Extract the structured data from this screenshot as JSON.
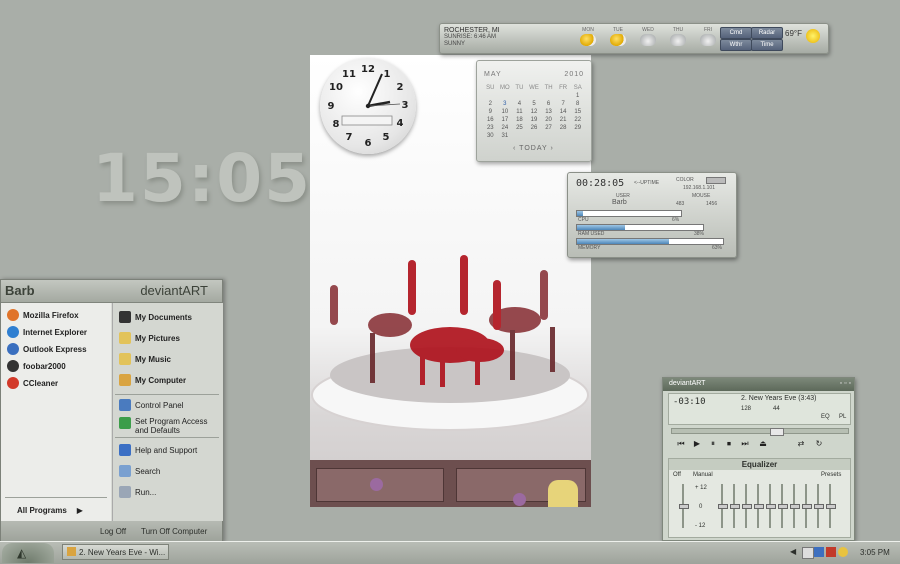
{
  "desktop": {
    "big_time": "15:05"
  },
  "clock_widget": {
    "numbers": [
      "12",
      "1",
      "2",
      "3",
      "4",
      "5",
      "6",
      "7",
      "8",
      "9",
      "10",
      "11"
    ],
    "time_shown": "2:11:15"
  },
  "calendar_widget": {
    "month": "MAY",
    "year": "2010",
    "weekdays": [
      "SU",
      "MO",
      "TU",
      "WE",
      "TH",
      "FR",
      "SA"
    ],
    "days": [
      "",
      "",
      "",
      "",
      "",
      "",
      "1",
      "2",
      "3",
      "4",
      "5",
      "6",
      "7",
      "8",
      "9",
      "10",
      "11",
      "12",
      "13",
      "14",
      "15",
      "16",
      "17",
      "18",
      "19",
      "20",
      "21",
      "22",
      "23",
      "24",
      "25",
      "26",
      "27",
      "28",
      "29",
      "30",
      "31"
    ],
    "today_label": "TODAY"
  },
  "weather_widget": {
    "location": "ROCHESTER, MI",
    "line2": "SUNRISE: 6:46 AM",
    "line3": "SUNNY",
    "days": [
      "MON",
      "TUE",
      "WED",
      "THU",
      "FRI"
    ],
    "buttons": [
      "Cmd",
      "Radar",
      "Wthr",
      "Time"
    ],
    "temperature": "69°F"
  },
  "system_monitor": {
    "uptime_value": "00:28:05",
    "uptime_label": "<--UPTIME",
    "color_label": "COLOR",
    "ip": "192.168.1.101",
    "mouse_label": "MOUSE",
    "user_label": "USER",
    "user_name": "Barb",
    "coords": "483",
    "coords2": "1456",
    "cpu_label": "CPU",
    "cpu_value": "6%",
    "cpu_pct": 6,
    "ram_label": "RAM USED",
    "ram_value": "38%",
    "ram_pct": 38,
    "mem_label": "MEMORY",
    "mem_value": "63%",
    "mem_pct": 63
  },
  "start_menu": {
    "user_name": "Barb",
    "brand": "deviantART",
    "pinned": [
      {
        "label": "Mozilla Firefox",
        "color": "#e0742a"
      },
      {
        "label": "Internet Explorer",
        "color": "#2f7fd1"
      },
      {
        "label": "Outlook Express",
        "color": "#3a6fbf"
      },
      {
        "label": "foobar2000",
        "color": "#333333"
      },
      {
        "label": "CCleaner",
        "color": "#d23a2a"
      }
    ],
    "all_programs": "All Programs",
    "places": [
      {
        "label": "My Documents",
        "color": "#333333"
      },
      {
        "label": "My Pictures",
        "color": "#e2c35a"
      },
      {
        "label": "My Music",
        "color": "#e2c35a"
      },
      {
        "label": "My Computer",
        "color": "#d9a441"
      }
    ],
    "system": [
      {
        "label": "Control Panel",
        "color": "#4a7bbf"
      },
      {
        "label": "Set Program Access",
        "label2": "and Defaults",
        "color": "#3c9d4a"
      },
      {
        "label": "Help and Support",
        "color": "#3b6fc4"
      },
      {
        "label": "Search",
        "color": "#7aa0d0"
      },
      {
        "label": "Run...",
        "color": "#9aa6b6"
      }
    ],
    "log_off": "Log Off",
    "turn_off": "Turn Off Computer"
  },
  "media_player": {
    "brand": "deviantART",
    "track_title": "2. New Years Eve (3:43)",
    "elapsed": "-03:10",
    "bitrate": "128",
    "samplerate": "44",
    "eq_btn": "EQ",
    "pl_btn": "PL",
    "equalizer_title": "Equalizer",
    "off_label": "Off",
    "preset_left": "Manual",
    "presets": "Presets",
    "scale_top": "+ 12",
    "scale_mid": "0",
    "scale_bottom": "- 12",
    "controls": {
      "prev": "⏮",
      "play": "▶",
      "pause": "⏸",
      "stop": "⏹",
      "eject": "⏏",
      "shuffle": "⇄",
      "repeat": "↻"
    }
  },
  "taskbar": {
    "task_label": "2. New Years Eve - Wi...",
    "clock": "3:05 PM"
  }
}
